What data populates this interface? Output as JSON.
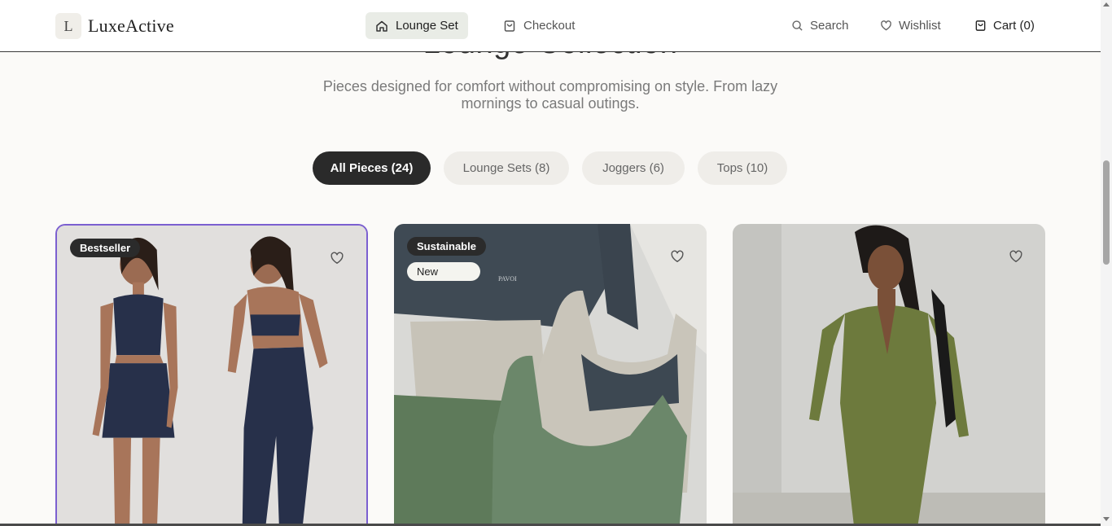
{
  "brand": {
    "mark": "L",
    "name": "LuxeActive"
  },
  "nav": {
    "lounge_set": "Lounge Set",
    "checkout": "Checkout",
    "search": "Search",
    "wishlist": "Wishlist",
    "cart": "Cart (0)"
  },
  "section": {
    "title": "Lounge Collection",
    "description": "Pieces designed for comfort without compromising on style. From lazy mornings to casual outings."
  },
  "filters": [
    {
      "label": "All Pieces (24)",
      "active": true
    },
    {
      "label": "Lounge Sets (8)",
      "active": false
    },
    {
      "label": "Joggers (6)",
      "active": false
    },
    {
      "label": "Tops (10)",
      "active": false
    }
  ],
  "products": [
    {
      "badges": [
        "Bestseller"
      ],
      "image": "navy tank top with skirt and flared leggings set",
      "accent": "#2b3350"
    },
    {
      "badges": [
        "Sustainable",
        "New"
      ],
      "image": "folded leggings and bra tops in slate, cream and sage",
      "accent": "#3f4a54"
    },
    {
      "badges": [],
      "image": "olive green zip-front long sleeve jumpsuit",
      "accent": "#6d7a3d"
    }
  ],
  "colors": {
    "accent_dark": "#2a2a2a",
    "nav_active_bg": "#e9ece6",
    "card_highlight": "#7b5fd0"
  },
  "icons": [
    "home-icon",
    "bag-icon",
    "search-icon",
    "heart-icon",
    "cart-icon"
  ]
}
